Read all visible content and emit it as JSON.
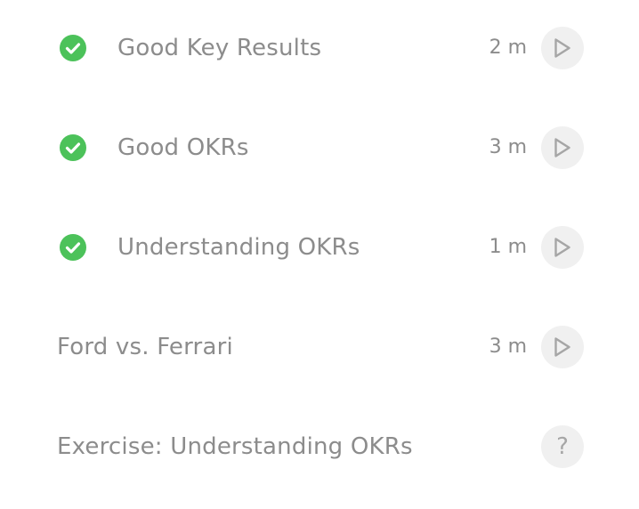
{
  "lessons": [
    {
      "title": "Good Key Results",
      "duration": "2 m",
      "completed": true,
      "action_icon": "play-icon"
    },
    {
      "title": "Good OKRs",
      "duration": "3 m",
      "completed": true,
      "action_icon": "play-icon"
    },
    {
      "title": "Understanding OKRs",
      "duration": "1 m",
      "completed": true,
      "action_icon": "play-icon"
    },
    {
      "title": "Ford vs. Ferrari",
      "duration": "3 m",
      "completed": false,
      "action_icon": "play-icon"
    },
    {
      "title": "Exercise: Understanding OKRs",
      "duration": "",
      "completed": false,
      "action_icon": "help-icon",
      "action_glyph": "?"
    }
  ],
  "colors": {
    "check": "#4cc25a",
    "text": "#8c8c8c",
    "button_bg": "#f0f0f0",
    "button_icon": "#a6a6a6"
  }
}
